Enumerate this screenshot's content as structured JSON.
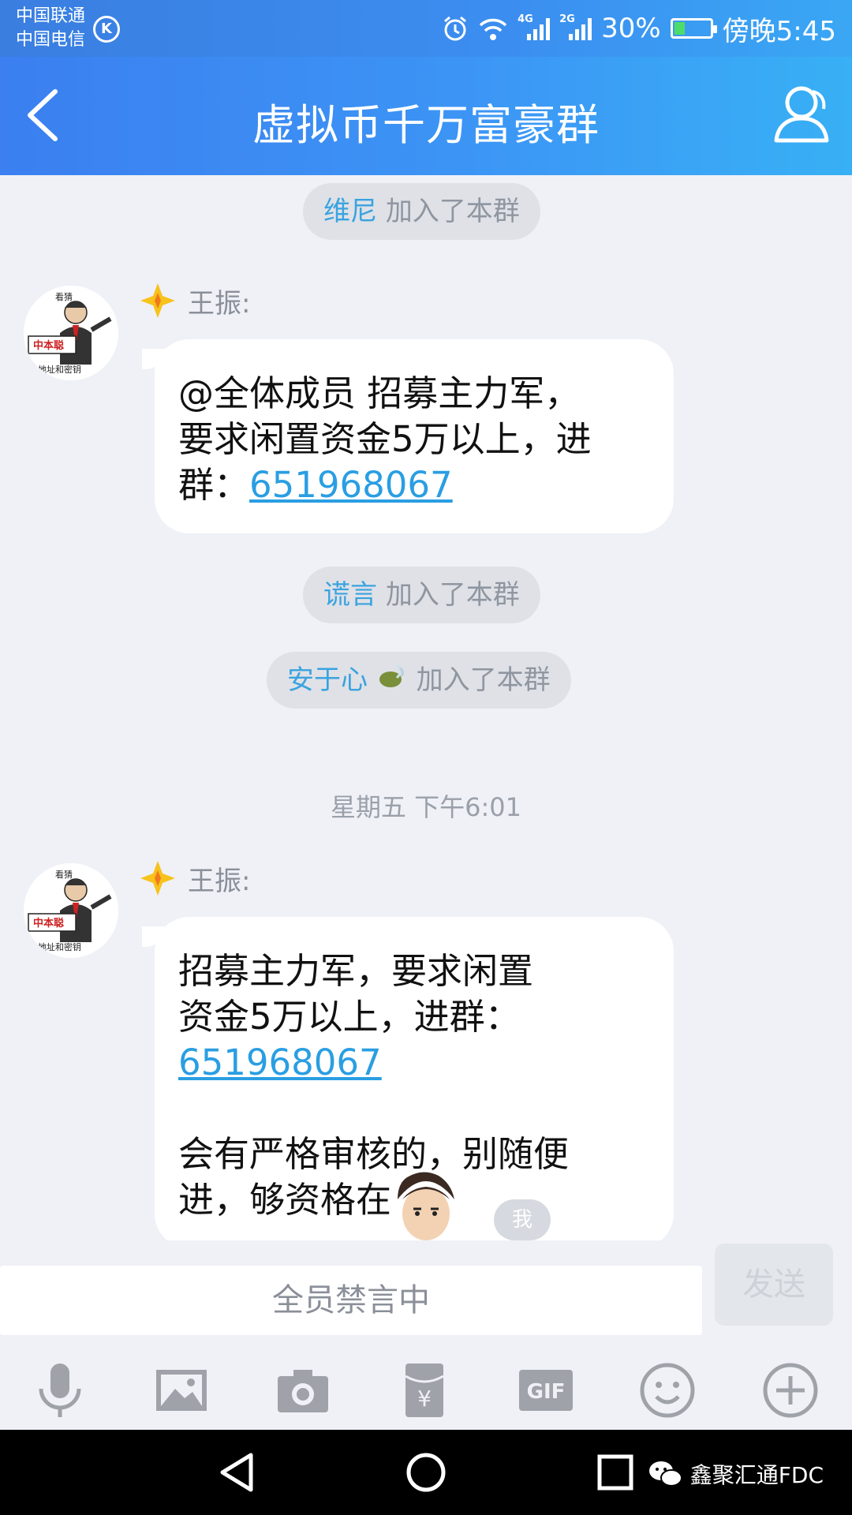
{
  "status_bar": {
    "carrier_1": "中国联通",
    "carrier_2": "中国电信",
    "network_1": "4G",
    "network_2": "2G",
    "battery": "30%",
    "battery_level": 0.3,
    "time": "傍晚5:45"
  },
  "header": {
    "title": "虚拟币千万富豪群",
    "back_icon": "chevron-left-icon",
    "members_icon": "person-outline-icon"
  },
  "messages": {
    "join_1": {
      "name": "维尼",
      "text": "加入了本群"
    },
    "msg_1": {
      "sender": "王振:",
      "line1": "@全体成员 招募主力军，",
      "line2": "要求闲置资金5万以上，进",
      "line3_prefix": "群：",
      "link": "651968067"
    },
    "join_2": {
      "name": "谎言",
      "text": "加入了本群"
    },
    "join_3": {
      "name": "安于心",
      "text": "加入了本群"
    },
    "timestamp": "星期五 下午6:01",
    "msg_2": {
      "sender": "王振:",
      "line1": "招募主力军，要求闲置",
      "line2": "资金5万以上，进群：",
      "link": "651968067",
      "line4": "会有严格审核的，别随便",
      "line5": "进，够资格在"
    },
    "avatar_caption_top": "看猜",
    "avatar_caption_mid": "中本聪",
    "avatar_caption_bottom": "地址和密钥",
    "me_badge": "我"
  },
  "input": {
    "placeholder": "全员禁言中",
    "send_label": "发送"
  },
  "toolbar": {
    "icons": [
      "microphone-icon",
      "image-icon",
      "camera-icon",
      "red-packet-icon",
      "gif-icon",
      "emoji-icon",
      "plus-icon"
    ],
    "gif_label": "GIF"
  },
  "nav": {
    "watermark": "鑫聚汇通FDC"
  },
  "colors": {
    "header_blue": "#3b8ef0",
    "link": "#2a9ee2",
    "name_blue": "#3aa3df",
    "pill_bg": "#dfe1e7"
  }
}
